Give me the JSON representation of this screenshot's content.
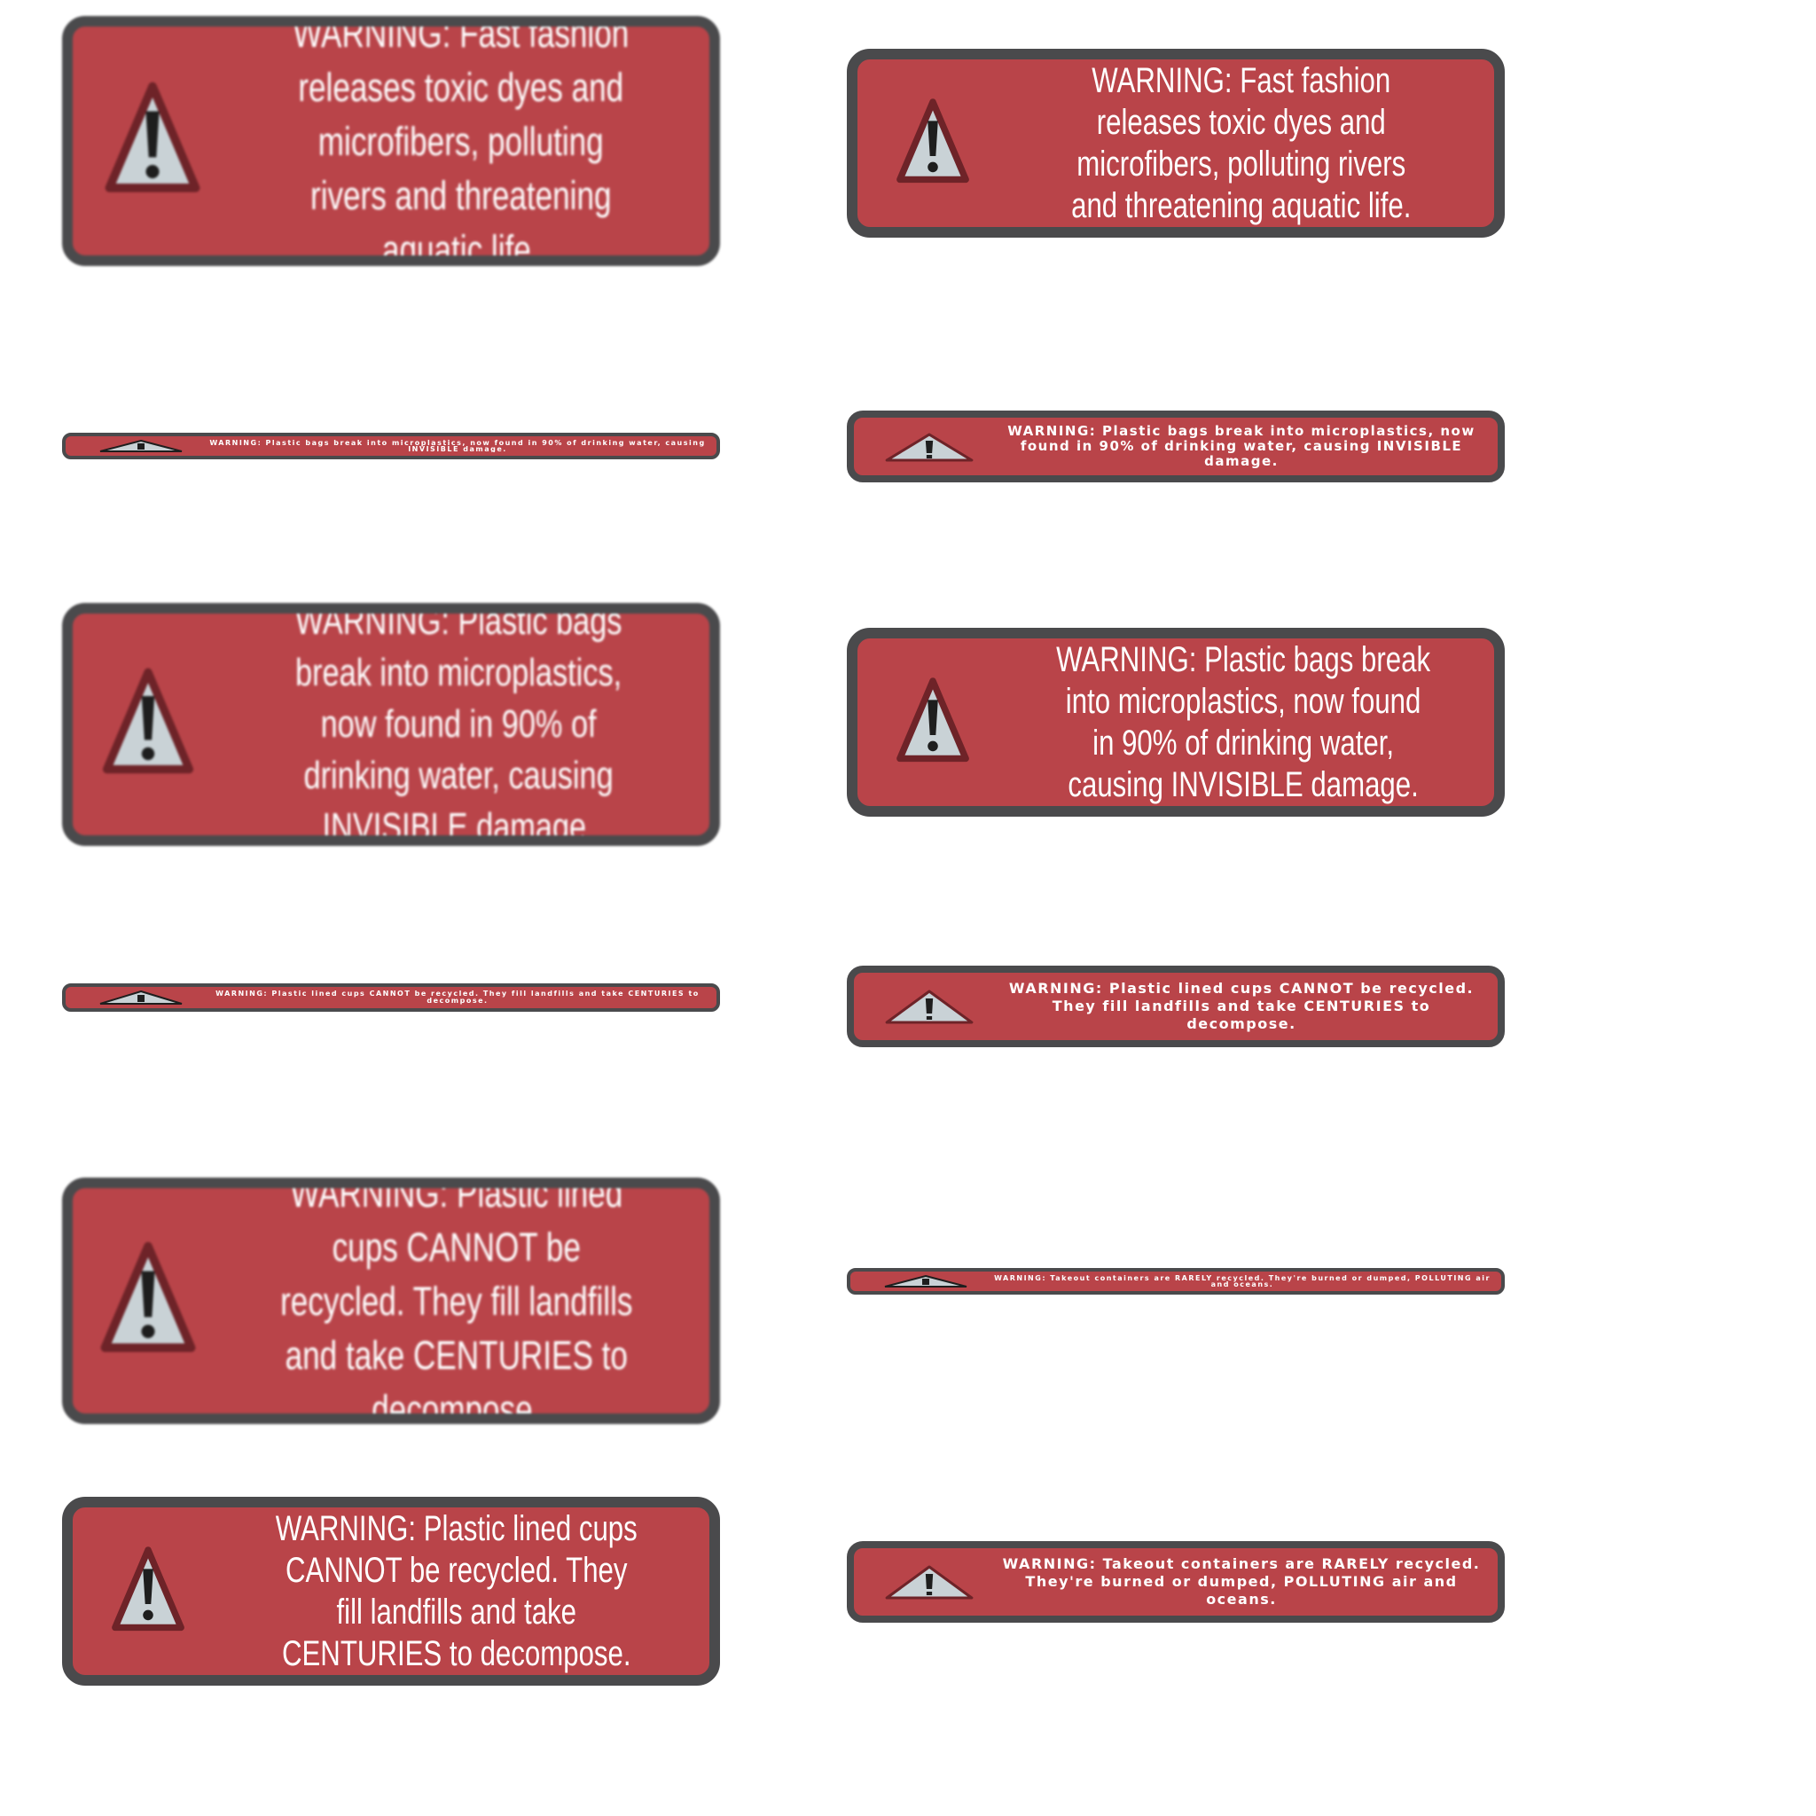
{
  "colors": {
    "label_fill": "#b94449",
    "label_border": "#4a4a4c",
    "icon_fill": "#c9d2d6",
    "icon_outline": "#6e2328",
    "text": "#ffffff"
  },
  "icon_name": "warning-triangle-icon",
  "labels": [
    {
      "text": "WARNING: Fast fashion releases toxic dyes and microfibers, polluting rivers and threatening aquatic life."
    },
    {
      "text": "WARNING: Fast fashion releases toxic dyes and microfibers, polluting rivers and threatening aquatic life."
    },
    {
      "text": "WARNING: Plastic bags break into microplastics, now found in 90% of drinking water, causing INVISIBLE damage."
    },
    {
      "text": "WARNING: Plastic bags break into microplastics, now found in 90% of drinking water, causing INVISIBLE damage."
    },
    {
      "text": "WARNING: Plastic bags break into microplastics, now found in 90% of drinking water, causing INVISIBLE damage."
    },
    {
      "text": "WARNING: Plastic bags break into microplastics, now found in 90% of drinking water, causing INVISIBLE damage."
    },
    {
      "text": "WARNING: Plastic lined cups CANNOT be recycled. They fill landfills and take CENTURIES to decompose."
    },
    {
      "text": "WARNING: Plastic lined cups CANNOT be recycled. They fill landfills and take CENTURIES to decompose."
    },
    {
      "text": "WARNING: Plastic lined cups CANNOT be recycled. They fill landfills and take CENTURIES to decompose."
    },
    {
      "text": "WARNING: Takeout containers are RARELY recycled. They're burned or dumped, POLLUTING air and oceans."
    },
    {
      "text": "WARNING: Plastic lined cups CANNOT be recycled. They fill landfills and take CENTURIES to decompose."
    },
    {
      "text": "WARNING: Takeout containers are RARELY recycled. They're burned or dumped, POLLUTING air and oceans."
    }
  ]
}
